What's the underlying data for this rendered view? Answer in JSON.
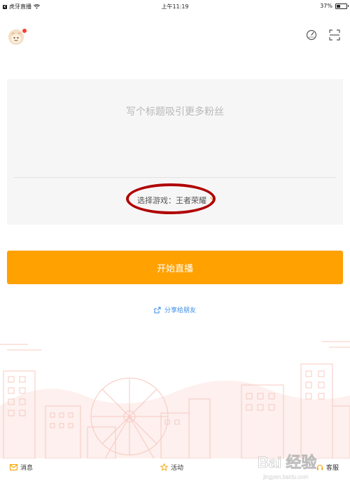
{
  "status_bar": {
    "carrier": "虎牙直播",
    "time": "上午11:19",
    "battery_pct": "37%",
    "battery_level": 0.37
  },
  "header": {
    "avatar_icon": "avatar-icon",
    "notification_dot_color": "#ff3b2f",
    "speed_icon": "speedometer-icon",
    "scan_icon": "scan-icon"
  },
  "form": {
    "title_placeholder": "写个标题吸引更多粉丝",
    "game_label": "选择游戏：王者荣耀"
  },
  "actions": {
    "start_label": "开始直播",
    "share_label": "分享给朋友"
  },
  "tabbar": {
    "messages": "消息",
    "activity": "活动",
    "service": "客服"
  },
  "colors": {
    "accent": "#ffa100",
    "link": "#3a8ee6",
    "annotation": "#b00000"
  },
  "watermark": {
    "text": "Bai 经验",
    "url": "jingyan.baidu.com"
  }
}
